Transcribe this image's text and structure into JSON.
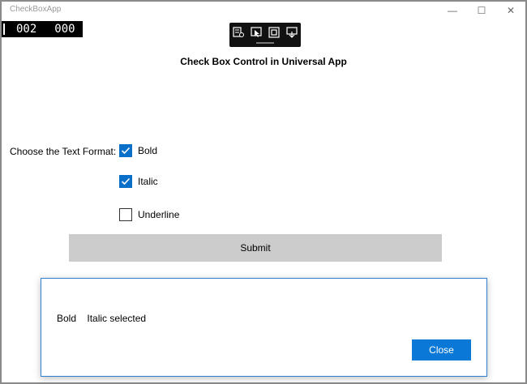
{
  "window": {
    "title": "CheckBoxApp",
    "min_glyph": "—",
    "max_glyph": "☐",
    "close_glyph": "✕"
  },
  "frame_counter": {
    "a": "002",
    "b": "000"
  },
  "debug_toolbar": {
    "icons": [
      "live-visual-tree-icon",
      "select-element-icon",
      "display-layout-adorners-icon",
      "track-focused-element-icon"
    ]
  },
  "page": {
    "heading": "Check Box Control in Universal App",
    "format_label": "Choose the Text Format:",
    "checkboxes": [
      {
        "label": "Bold",
        "checked": true
      },
      {
        "label": "Italic",
        "checked": true
      },
      {
        "label": "Underline",
        "checked": false
      }
    ],
    "submit_label": "Submit"
  },
  "dialog": {
    "message": "Bold    Italic selected",
    "close_label": "Close"
  },
  "colors": {
    "accent": "#0a78d7",
    "checkbox_checked": "#0a6fc8",
    "submit_bg": "#cccccc",
    "dialog_border": "#2f7fce"
  }
}
